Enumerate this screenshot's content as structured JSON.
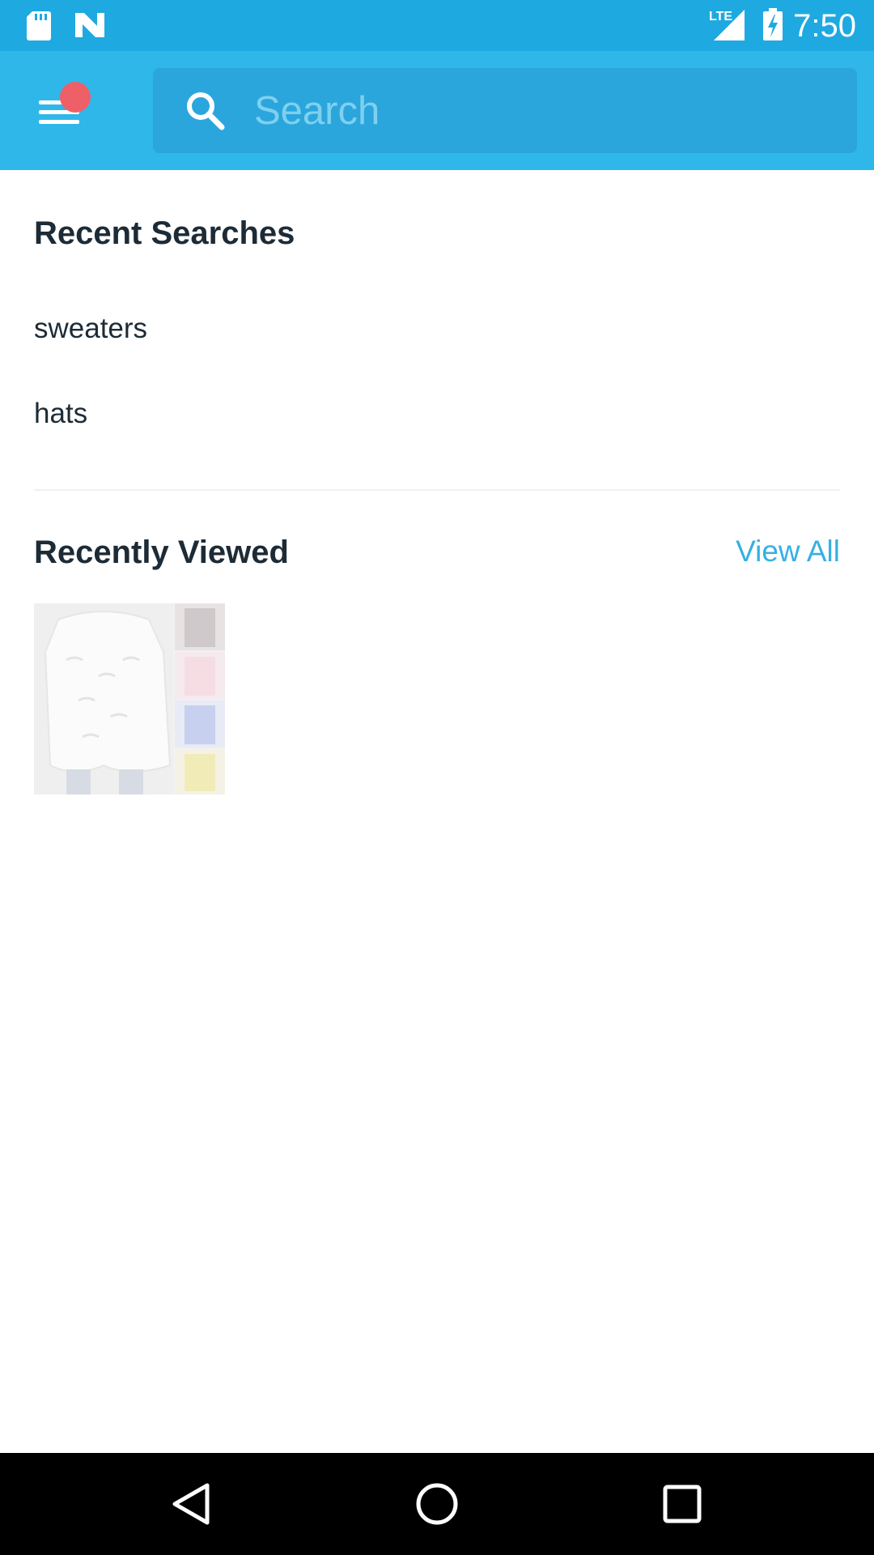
{
  "status_bar": {
    "time": "7:50",
    "network": "LTE",
    "icons": [
      "sd-card-icon",
      "n-logo-icon",
      "signal-icon",
      "battery-charging-icon"
    ]
  },
  "app_bar": {
    "menu_icon": "menu-icon",
    "search": {
      "placeholder": "Search",
      "value": ""
    }
  },
  "recent_searches": {
    "title": "Recent Searches",
    "items": [
      "sweaters",
      "hats"
    ]
  },
  "recently_viewed": {
    "title": "Recently Viewed",
    "view_all": "View All",
    "items": [
      {
        "image": "white-sweater-product-thumbnail"
      }
    ]
  },
  "nav_bar": {
    "icons": [
      "back-icon",
      "home-icon",
      "recents-icon"
    ]
  },
  "colors": {
    "status_bar": "#1fa9e1",
    "app_bar": "#2fb7ea",
    "search_box": "#2ba6dc",
    "badge": "#ef5f67",
    "accent_link": "#36b0e3",
    "text_dark": "#1d2b36"
  }
}
